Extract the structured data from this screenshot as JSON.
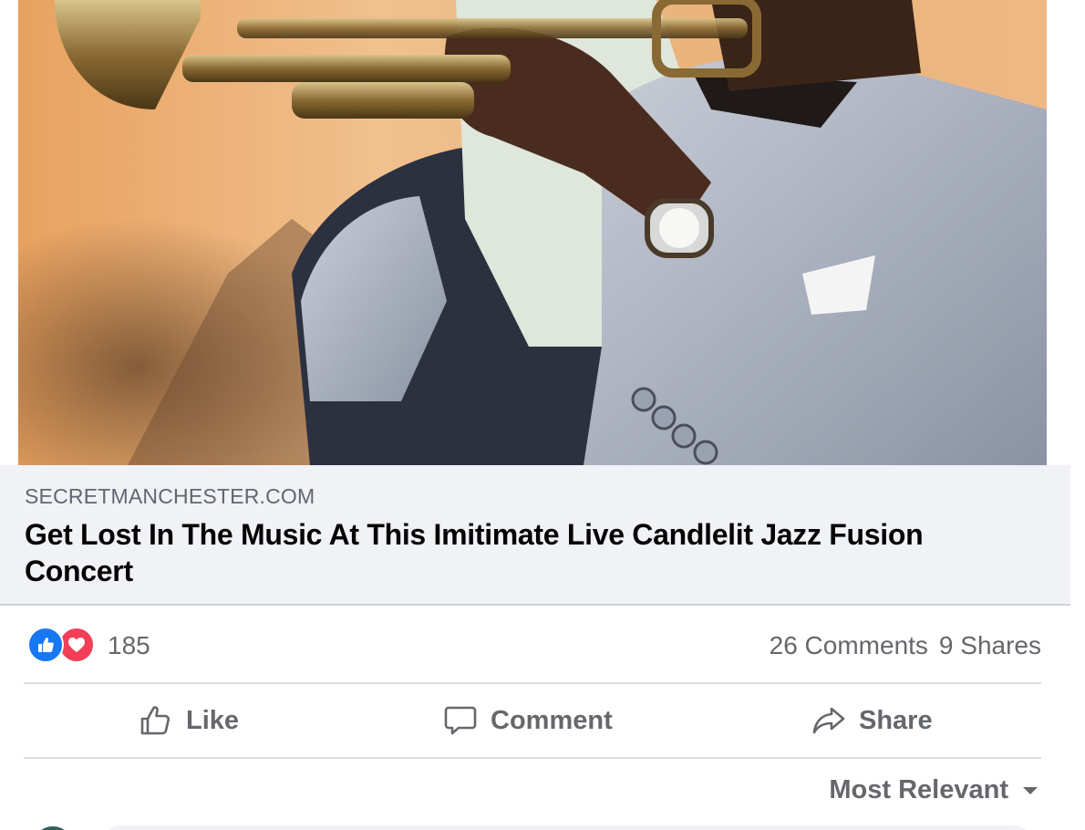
{
  "post": {
    "image_description": "trumpet-player-photo",
    "link": {
      "domain": "SECRETMANCHESTER.COM",
      "title": "Get Lost In The Music At This Imitimate Live Candlelit Jazz Fusion Concert"
    },
    "reactions": {
      "icons": [
        "like-icon",
        "love-icon"
      ],
      "count": "185"
    },
    "engagement": {
      "comments": "26 Comments",
      "shares": "9 Shares"
    },
    "actions": {
      "like": "Like",
      "comment": "Comment",
      "share": "Share"
    },
    "comments_sort": {
      "label": "Most Relevant"
    }
  },
  "colors": {
    "like_blue": "#1877f2",
    "love_red": "#f33e58",
    "secondary_text": "#65676b",
    "preview_bg": "#f0f2f5"
  }
}
